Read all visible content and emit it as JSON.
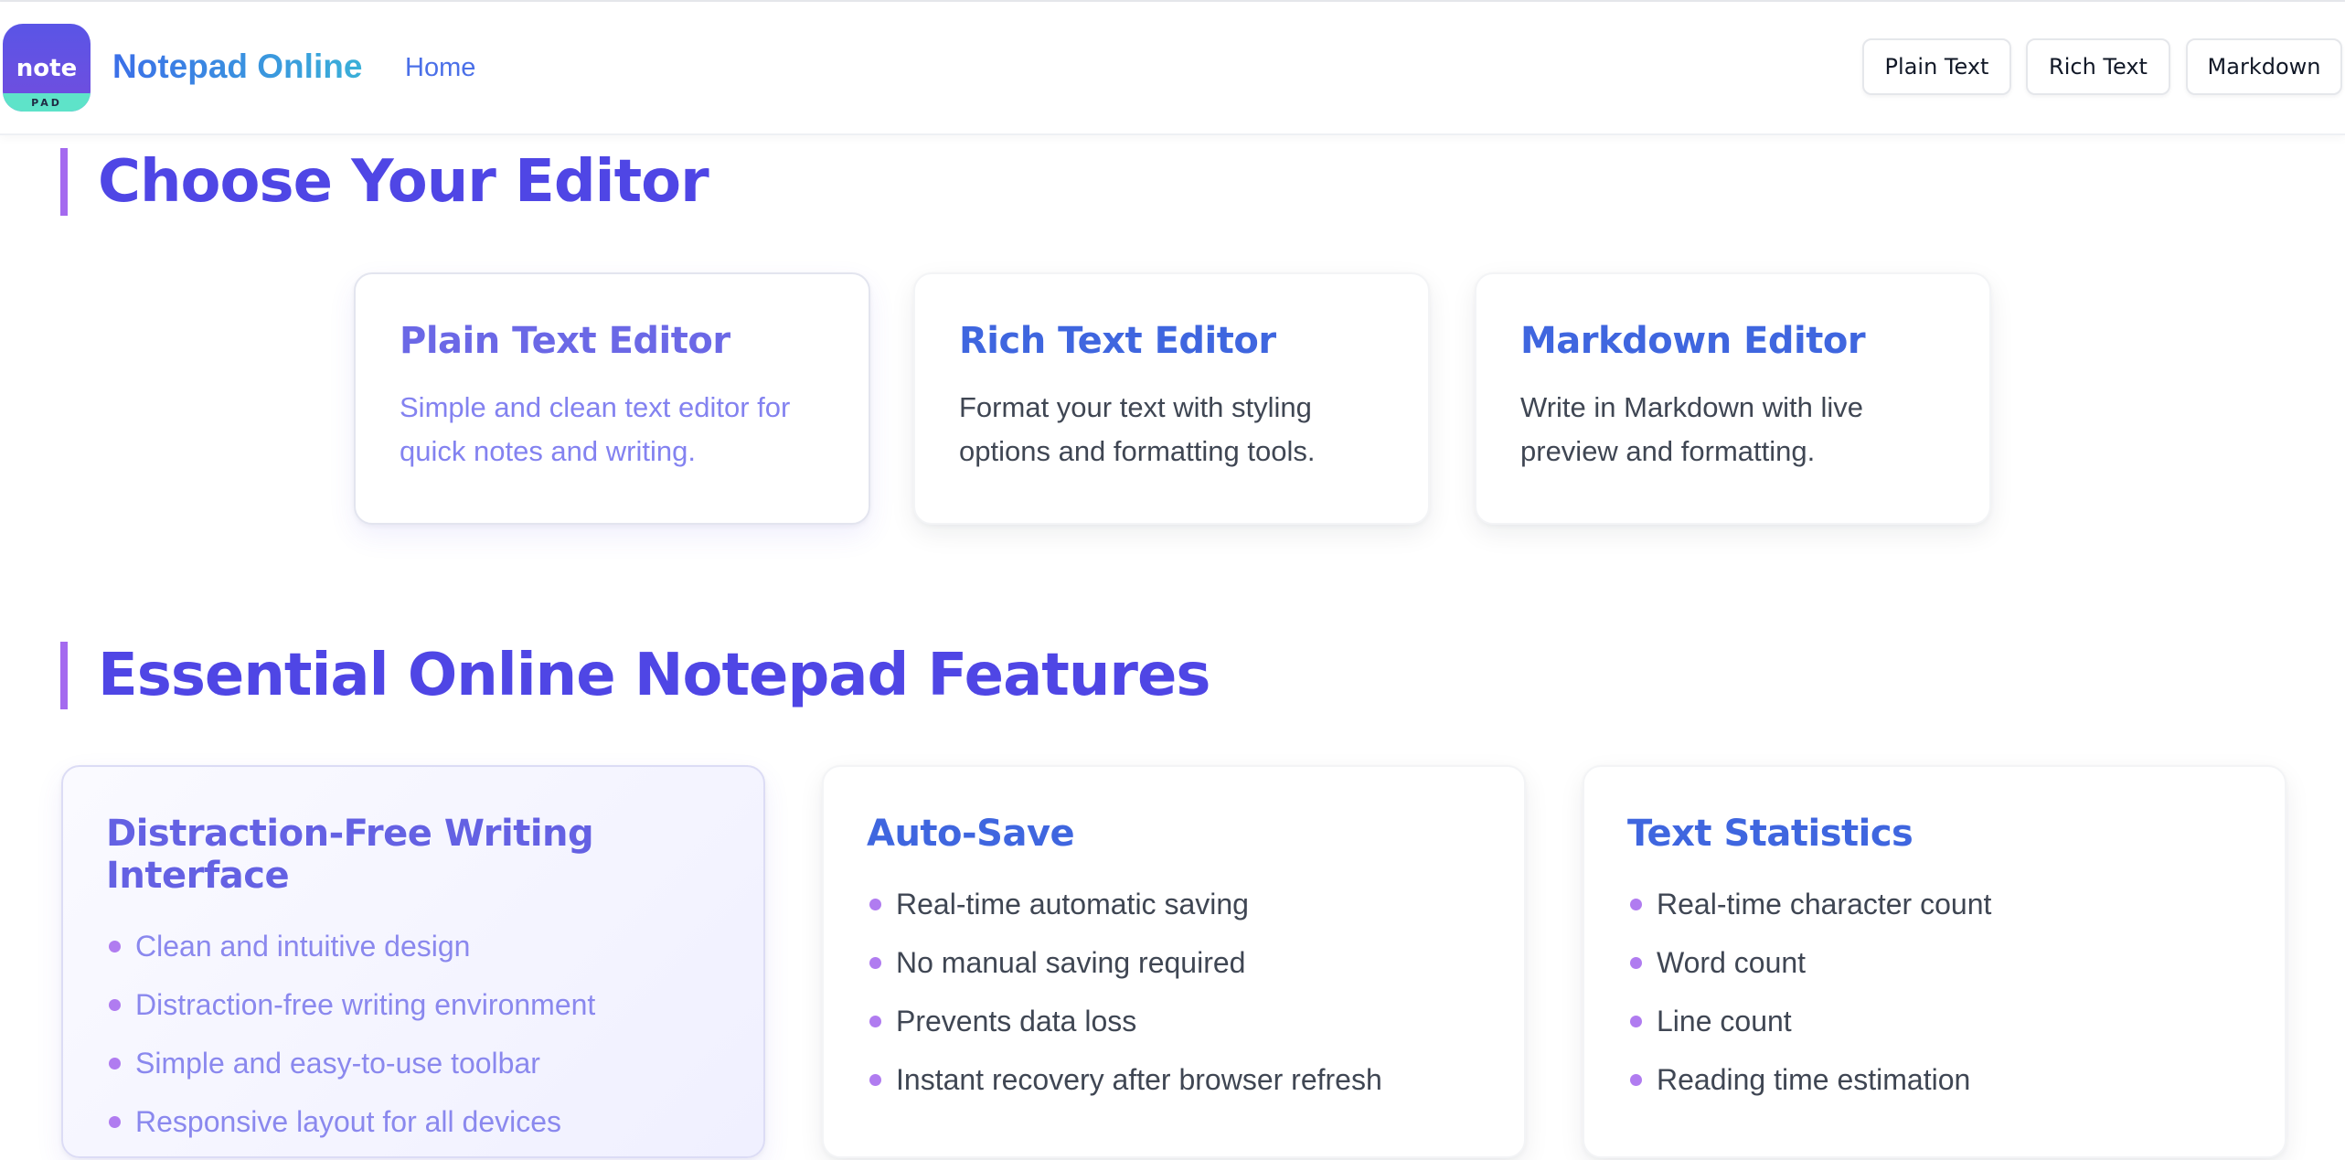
{
  "header": {
    "logo": {
      "word": "note",
      "sub": "PAD",
      "colors": {
        "top": "#5a55e6",
        "band": "#5ee3c9"
      }
    },
    "brand": "Notepad Online",
    "nav": {
      "home": "Home"
    },
    "buttons": [
      "Plain Text",
      "Rich Text",
      "Markdown"
    ]
  },
  "choose_section": {
    "title": "Choose Your Editor",
    "editors": [
      {
        "title": "Plain Text Editor",
        "description": "Simple and clean text editor for quick notes and writing.",
        "active": true
      },
      {
        "title": "Rich Text Editor",
        "description": "Format your text with styling options and formatting tools."
      },
      {
        "title": "Markdown Editor",
        "description": "Write in Markdown with live preview and formatting."
      }
    ]
  },
  "features_section": {
    "title": "Essential Online Notepad Features",
    "cards": [
      {
        "title": "Distraction-Free Writing Interface",
        "active": true,
        "items": [
          "Clean and intuitive design",
          "Distraction-free writing environment",
          "Simple and easy-to-use toolbar",
          "Responsive layout for all devices"
        ]
      },
      {
        "title": "Auto-Save",
        "items": [
          "Real-time automatic saving",
          "No manual saving required",
          "Prevents data loss",
          "Instant recovery after browser refresh"
        ]
      },
      {
        "title": "Text Statistics",
        "items": [
          "Real-time character count",
          "Word count",
          "Line count",
          "Reading time estimation"
        ]
      }
    ]
  },
  "colors": {
    "accent": "#4f46e5",
    "title_bar": "#a46aef",
    "link": "#3f66df",
    "bullet": "#b07cf0"
  }
}
